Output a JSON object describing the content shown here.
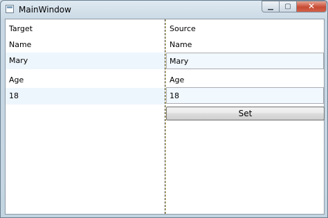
{
  "window": {
    "title": "MainWindow",
    "minimize": "▁",
    "maximize": "▢",
    "close": "✕"
  },
  "target": {
    "header": "Target",
    "name_label": "Name",
    "name_value": "Mary",
    "age_label": "Age",
    "age_value": "18"
  },
  "source": {
    "header": "Source",
    "name_label": "Name",
    "name_value": "Mary",
    "age_label": "Age",
    "age_value": "18",
    "set_button": "Set"
  }
}
